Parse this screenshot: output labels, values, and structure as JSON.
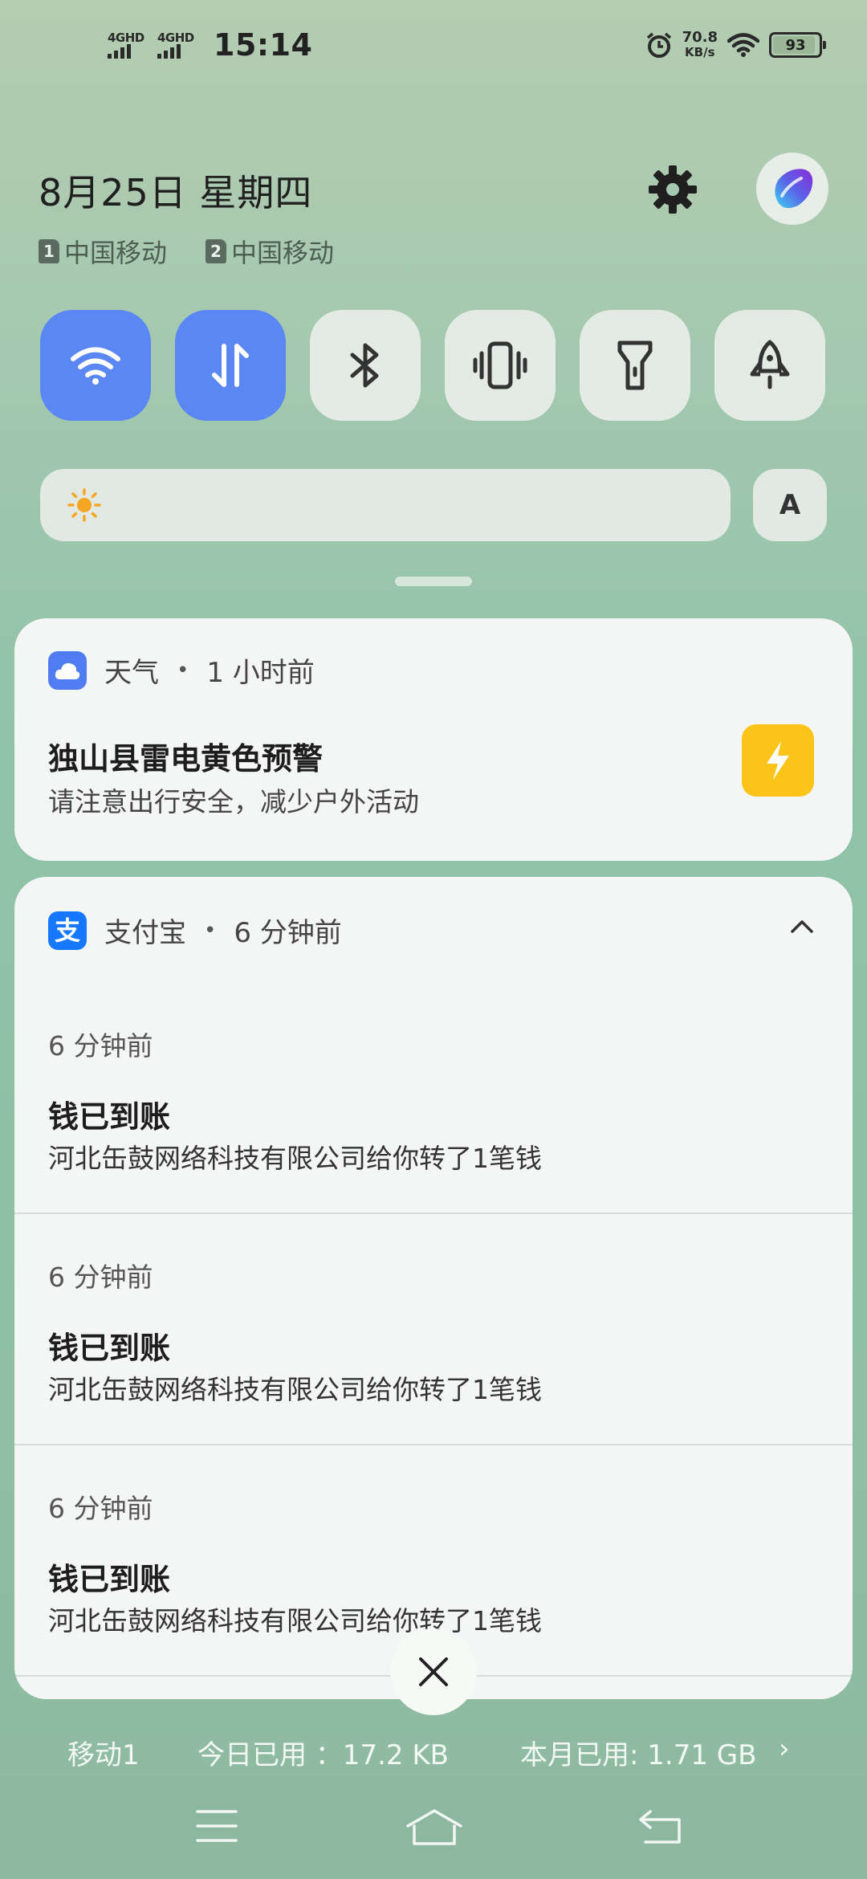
{
  "status_bar": {
    "sim1_label": "4GHD",
    "sim2_label": "4GHD",
    "time": "15:14",
    "net_speed_value": "70.8",
    "net_speed_unit": "KB/s",
    "battery": "93",
    "icons": [
      "signal-icon",
      "signal-icon",
      "alarm-icon",
      "wifi-icon",
      "battery-icon"
    ]
  },
  "header": {
    "date": "8月25日  星期四",
    "carriers": [
      {
        "slot": "1",
        "name": "中国移动"
      },
      {
        "slot": "2",
        "name": "中国移动"
      }
    ]
  },
  "quick_tiles": [
    {
      "name": "wifi",
      "icon": "wifi-icon",
      "active": true
    },
    {
      "name": "mobile-data",
      "icon": "data-arrows-icon",
      "active": true
    },
    {
      "name": "bluetooth",
      "icon": "bluetooth-icon",
      "active": false
    },
    {
      "name": "vibrate",
      "icon": "vibrate-icon",
      "active": false
    },
    {
      "name": "flashlight",
      "icon": "flashlight-icon",
      "active": false
    },
    {
      "name": "rocket",
      "icon": "rocket-icon",
      "active": false
    }
  ],
  "brightness": {
    "auto_label": "A",
    "level": 0.0
  },
  "notifications": {
    "weather": {
      "app": "天气",
      "time": "1 小时前",
      "title": "独山县雷电黄色预警",
      "body": "请注意出行安全，减少户外活动"
    },
    "alipay": {
      "app": "支付宝",
      "time": "6 分钟前",
      "items": [
        {
          "time": "6 分钟前",
          "title": "钱已到账",
          "body": "河北缶鼓网络科技有限公司给你转了1笔钱"
        },
        {
          "time": "6 分钟前",
          "title": "钱已到账",
          "body": "河北缶鼓网络科技有限公司给你转了1笔钱"
        },
        {
          "time": "6 分钟前",
          "title": "钱已到账",
          "body": "河北缶鼓网络科技有限公司给你转了1笔钱"
        }
      ]
    }
  },
  "data_usage": {
    "sim": "移动1",
    "today": "今日已用 ：17.2  KB",
    "month": "本月已用: 1.71  GB",
    "chevron": "›"
  },
  "colors": {
    "accent": "#5b87f4",
    "weather_icon": "#4f7cf2",
    "alipay_icon": "#1677ff",
    "warning": "#fcc418"
  }
}
